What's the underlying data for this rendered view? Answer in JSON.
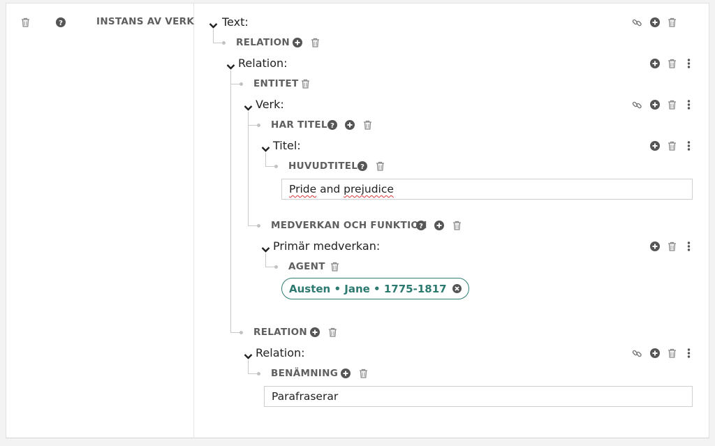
{
  "left_column": {
    "label": "INSTANS AV VERK"
  },
  "tree": {
    "text_heading": "Text:",
    "relation_label_1": "RELATION",
    "relation_heading_1": "Relation:",
    "entitet_label": "ENTITET",
    "verk_heading": "Verk:",
    "har_titel_label": "HAR TITEL",
    "titel_heading": "Titel:",
    "huvudtitel_label": "HUVUDTITEL",
    "huvudtitel_value_word1": "Pride",
    "huvudtitel_value_word2": " and ",
    "huvudtitel_value_word3": "prejudice",
    "medverkan_label": "MEDVERKAN OCH FUNKTION",
    "primar_heading": "Primär medverkan:",
    "agent_label": "AGENT",
    "agent_chip": "Austen • Jane • 1775-1817",
    "relation_label_2": "RELATION",
    "relation_heading_2": "Relation:",
    "benamning_label": "BENÄMNING",
    "benamning_value": "Parafraserar"
  },
  "icons": {
    "trash": "trash-icon",
    "help": "help-icon",
    "add": "add-icon",
    "link": "link-icon",
    "more": "more-icon",
    "chevron": "chevron-down-icon",
    "remove": "remove-icon"
  },
  "colors": {
    "icon_gray": "#7a7a7a",
    "chip_teal": "#2c7a6f",
    "tree_line": "#c8c8c8"
  }
}
